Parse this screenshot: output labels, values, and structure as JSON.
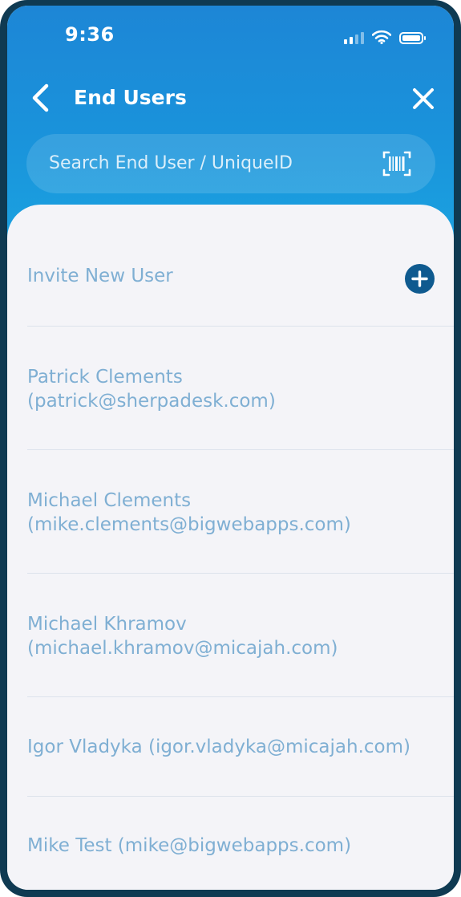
{
  "status_bar": {
    "time": "9:36",
    "signal_icon": "cellular-signal-icon",
    "wifi_icon": "wifi-icon",
    "battery_icon": "battery-icon"
  },
  "nav": {
    "title": "End Users",
    "back_icon": "chevron-left-icon",
    "close_icon": "close-icon"
  },
  "search": {
    "placeholder": "Search End User / UniqueID",
    "scan_icon": "barcode-scan-icon"
  },
  "list": {
    "invite_label": "Invite New User",
    "invite_icon": "plus-circle-icon",
    "users": [
      {
        "name_line": "Patrick Clements",
        "email_line": "(patrick@sherpadesk.com)"
      },
      {
        "name_line": "Michael Clements",
        "email_line": "(mike.clements@bigwebapps.com)"
      },
      {
        "name_line": "Michael Khramov",
        "email_line": "(michael.khramov@micajah.com)"
      },
      {
        "label": "Igor Vladyka (igor.vladyka@micajah.com)"
      },
      {
        "label": "Mike Test (mike@bigwebapps.com)"
      }
    ]
  },
  "colors": {
    "header_top": "#1d86d6",
    "header_bottom": "#1ba2e0",
    "list_text": "#7fafd3",
    "add_button": "#0f5a8f",
    "background": "#f4f4f8",
    "device_frame": "#0f3a52"
  }
}
